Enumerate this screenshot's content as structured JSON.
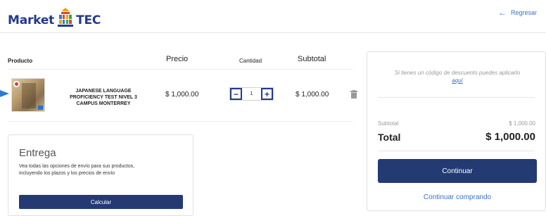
{
  "header": {
    "logo_left": "Market",
    "logo_right": "TEC",
    "back_label": "Regresar"
  },
  "cart": {
    "columns": {
      "product": "Producto",
      "price": "Precio",
      "quantity": "Cantidad",
      "subtotal": "Subtotal"
    },
    "items": [
      {
        "name": "JAPANESE LANGUAGE PROFICIENCY TEST NIVEL 3 CAMPUS MONTERREY",
        "price": "$ 1,000.00",
        "quantity": "1",
        "subtotal": "$ 1,000.00"
      }
    ]
  },
  "delivery": {
    "title": "Entrega",
    "description": "Vea todas las opciones de envío para sus productos, incluyendo los plazos y los precios de envío",
    "button_label": "Calcular"
  },
  "summary": {
    "discount_text": "Si tienes un código de descuento puedes aplicarlo",
    "discount_link": "aquí",
    "subtotal_label": "Subtotal",
    "subtotal_value": "$ 1,000.00",
    "total_label": "Total",
    "total_value": "$ 1,000.00",
    "continue_label": "Continuar",
    "keep_shopping_label": "Continuar comprando"
  },
  "colors": {
    "brand": "#233a8b",
    "button": "#233a73",
    "link": "#3b6fc9"
  },
  "icons": [
    "logo-building-icon",
    "arrow-left-icon",
    "minus-icon",
    "plus-icon",
    "trash-icon"
  ]
}
